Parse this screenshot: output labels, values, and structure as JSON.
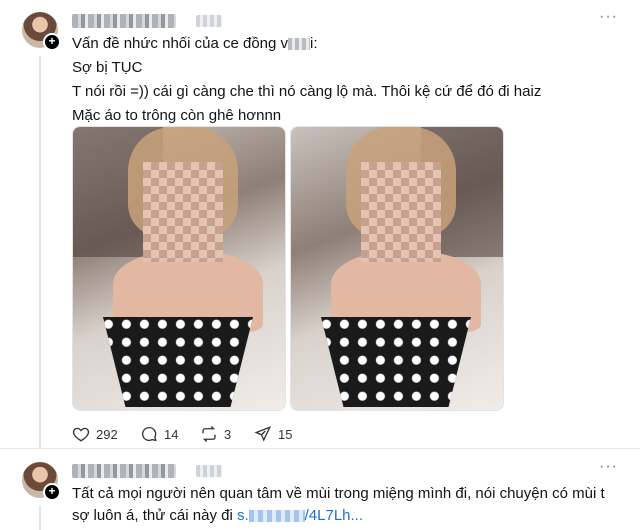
{
  "post1": {
    "text_line1": "Vấn đề nhức nhối của ce đồng v",
    "text_line1_tail": "i:",
    "text_line2": "Sợ bị TỤC",
    "text_line3": "T nói rồi =)) cái gì càng che thì nó càng lộ mà. Thôi kệ cứ để đó đi haiz",
    "text_line4": "Mặc áo to trông còn ghê hơnnn",
    "actions": {
      "likes": "292",
      "replies": "14",
      "reposts": "3",
      "shares": "15"
    }
  },
  "post2": {
    "text_line1": "Tất cả mọi người nên quan tâm về mùi trong miệng mình đi, nói chuyện có mùi t",
    "text_line2": "sợ luôn á, thử cái này đi ",
    "link_prefix": "s.",
    "link_suffix": "/4L7Lh..."
  }
}
